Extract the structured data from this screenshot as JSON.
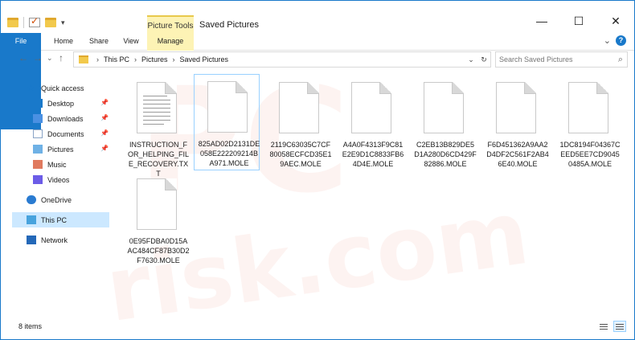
{
  "window": {
    "title": "Saved Pictures",
    "tool_tab": "Picture Tools",
    "controls": {
      "minimize": "—",
      "maximize": "☐",
      "close": "✕"
    }
  },
  "ribbon": {
    "tabs": [
      "File",
      "Home",
      "Share",
      "View",
      "Manage"
    ],
    "expand": "⌄",
    "help": "?"
  },
  "nav": {
    "back": "←",
    "forward": "→",
    "recent": "⌄",
    "up": "↑",
    "breadcrumb": [
      "This PC",
      "Pictures",
      "Saved Pictures"
    ],
    "refresh": "↻",
    "search_placeholder": "Search Saved Pictures"
  },
  "sidebar": {
    "items": [
      {
        "label": "Quick access",
        "icon": "star-icon"
      },
      {
        "label": "Desktop",
        "icon": "desktop-icon",
        "pinned": true
      },
      {
        "label": "Downloads",
        "icon": "downloads-icon",
        "pinned": true
      },
      {
        "label": "Documents",
        "icon": "documents-icon",
        "pinned": true
      },
      {
        "label": "Pictures",
        "icon": "pictures-icon",
        "pinned": true
      },
      {
        "label": "Music",
        "icon": "music-icon"
      },
      {
        "label": "Videos",
        "icon": "videos-icon"
      },
      {
        "label": "OneDrive",
        "icon": "onedrive-icon"
      },
      {
        "label": "This PC",
        "icon": "pc-icon",
        "selected": true
      },
      {
        "label": "Network",
        "icon": "network-icon"
      }
    ]
  },
  "files": [
    {
      "name": "INSTRUCTION_FOR_HELPING_FILE_RECOVERY.TXT",
      "type": "txt"
    },
    {
      "name": "825AD02D2131DE058E222209214BA971.MOLE",
      "type": "mole",
      "selected": true
    },
    {
      "name": "2119C63035C7CF80058ECFCD35E19AEC.MOLE",
      "type": "mole"
    },
    {
      "name": "A4A0F4313F9C81E2E9D1C8833FB64D4E.MOLE",
      "type": "mole"
    },
    {
      "name": "C2EB13B829DE5D1A280D6CD429F82886.MOLE",
      "type": "mole"
    },
    {
      "name": "F6D451362A9AA2D4DF2C561F2AB46E40.MOLE",
      "type": "mole"
    },
    {
      "name": "1DC8194F04367CEED5EE7CD90450485A.MOLE",
      "type": "mole"
    },
    {
      "name": "0E95FDBA0D15AAC484CF87B30D2F7630.MOLE",
      "type": "mole"
    }
  ],
  "status": {
    "item_count": "8 items"
  },
  "colors": {
    "accent": "#1979ca",
    "tools_tab": "#fdf3b5",
    "selected_bg": "#cce8ff"
  }
}
